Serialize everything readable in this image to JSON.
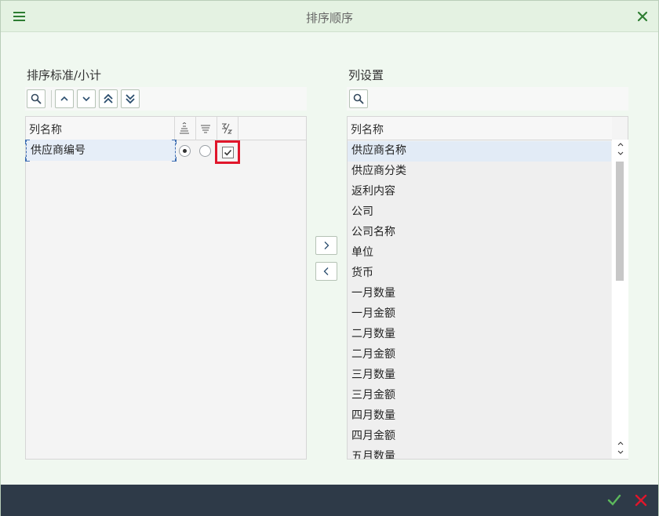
{
  "dialog": {
    "title": "排序顺序"
  },
  "sort_panel": {
    "label": "排序标准/小计",
    "column_header": "列名称",
    "rows": [
      {
        "name": "供应商编号",
        "ascending": true,
        "descending": false,
        "subtotal": true
      }
    ]
  },
  "columns_panel": {
    "label": "列设置",
    "column_header": "列名称",
    "items": [
      "供应商名称",
      "供应商分类",
      "返利内容",
      "公司",
      "公司名称",
      "单位",
      "货币",
      "一月数量",
      "一月金额",
      "二月数量",
      "二月金额",
      "三月数量",
      "三月金额",
      "四月数量",
      "四月金额",
      "五月数量"
    ],
    "selected_index": 0
  },
  "colors": {
    "accent_green": "#2e7d32",
    "highlight_red": "#e0162b",
    "footer_bg": "#2e3a48",
    "confirm_green": "#5cb85c",
    "cancel_red": "#e0162b"
  },
  "icons": {
    "menu": "hamburger-icon",
    "close": "close-icon",
    "search": "search-icon",
    "move_up": "chevron-up-icon",
    "move_down": "chevron-down-icon",
    "move_top": "double-chevron-up-icon",
    "move_bottom": "double-chevron-down-icon",
    "ascending": "sort-ascending-icon",
    "descending": "sort-descending-icon",
    "subtotal": "subtotal-icon",
    "add": "chevron-right-icon",
    "remove": "chevron-left-icon",
    "confirm": "check-icon",
    "cancel": "cancel-icon"
  }
}
